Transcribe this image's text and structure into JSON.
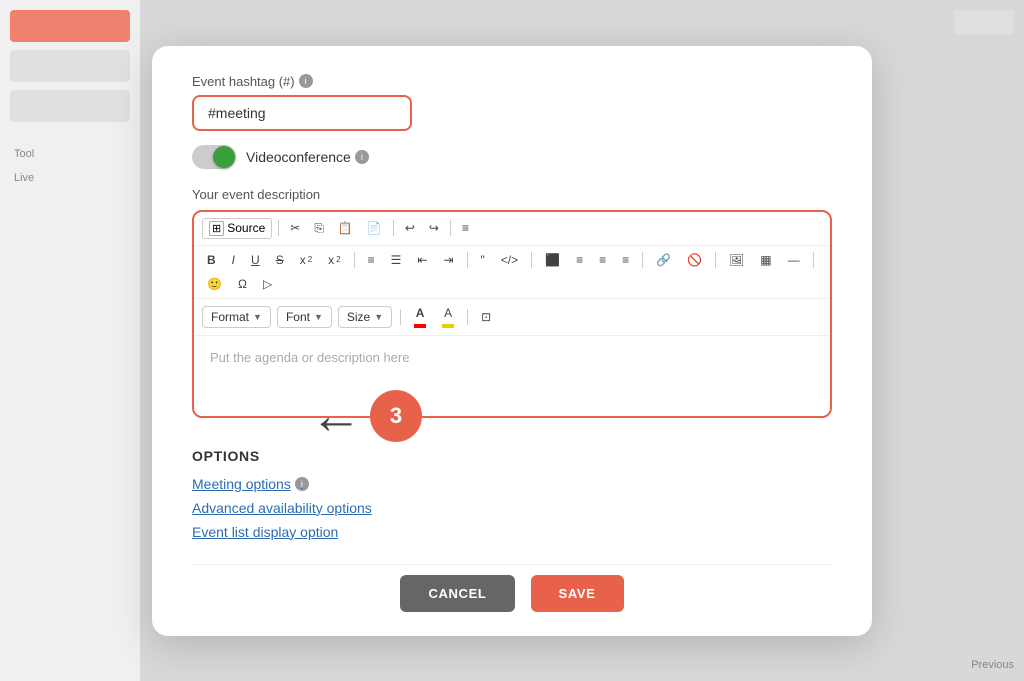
{
  "modal": {
    "hashtag_label": "Event hashtag (#)",
    "hashtag_value": "#meeting",
    "hashtag_placeholder": "#meeting",
    "videoconf_label": "Videoconference",
    "description_label": "Your event description",
    "description_placeholder": "Put the agenda or description here",
    "source_btn": "Source",
    "format_label": "Format",
    "font_label": "Font",
    "size_label": "Size",
    "options_title": "OPTIONS",
    "link_meeting_options": "Meeting options",
    "link_advanced": "Advanced availability options",
    "link_event_list": "Event list display option",
    "cancel_label": "CANCEL",
    "save_label": "SAVE"
  },
  "annotation": {
    "number": "3"
  },
  "toolbar": {
    "buttons": [
      "B",
      "I",
      "U",
      "S",
      "x₂",
      "x²",
      "ol",
      "ul",
      "outdent",
      "indent",
      "blockquote",
      "code",
      "align-left",
      "align-center",
      "align-right",
      "align-justify",
      "link",
      "unlink",
      "image",
      "table",
      "hr",
      "emoji",
      "omega",
      "indent-more"
    ]
  }
}
